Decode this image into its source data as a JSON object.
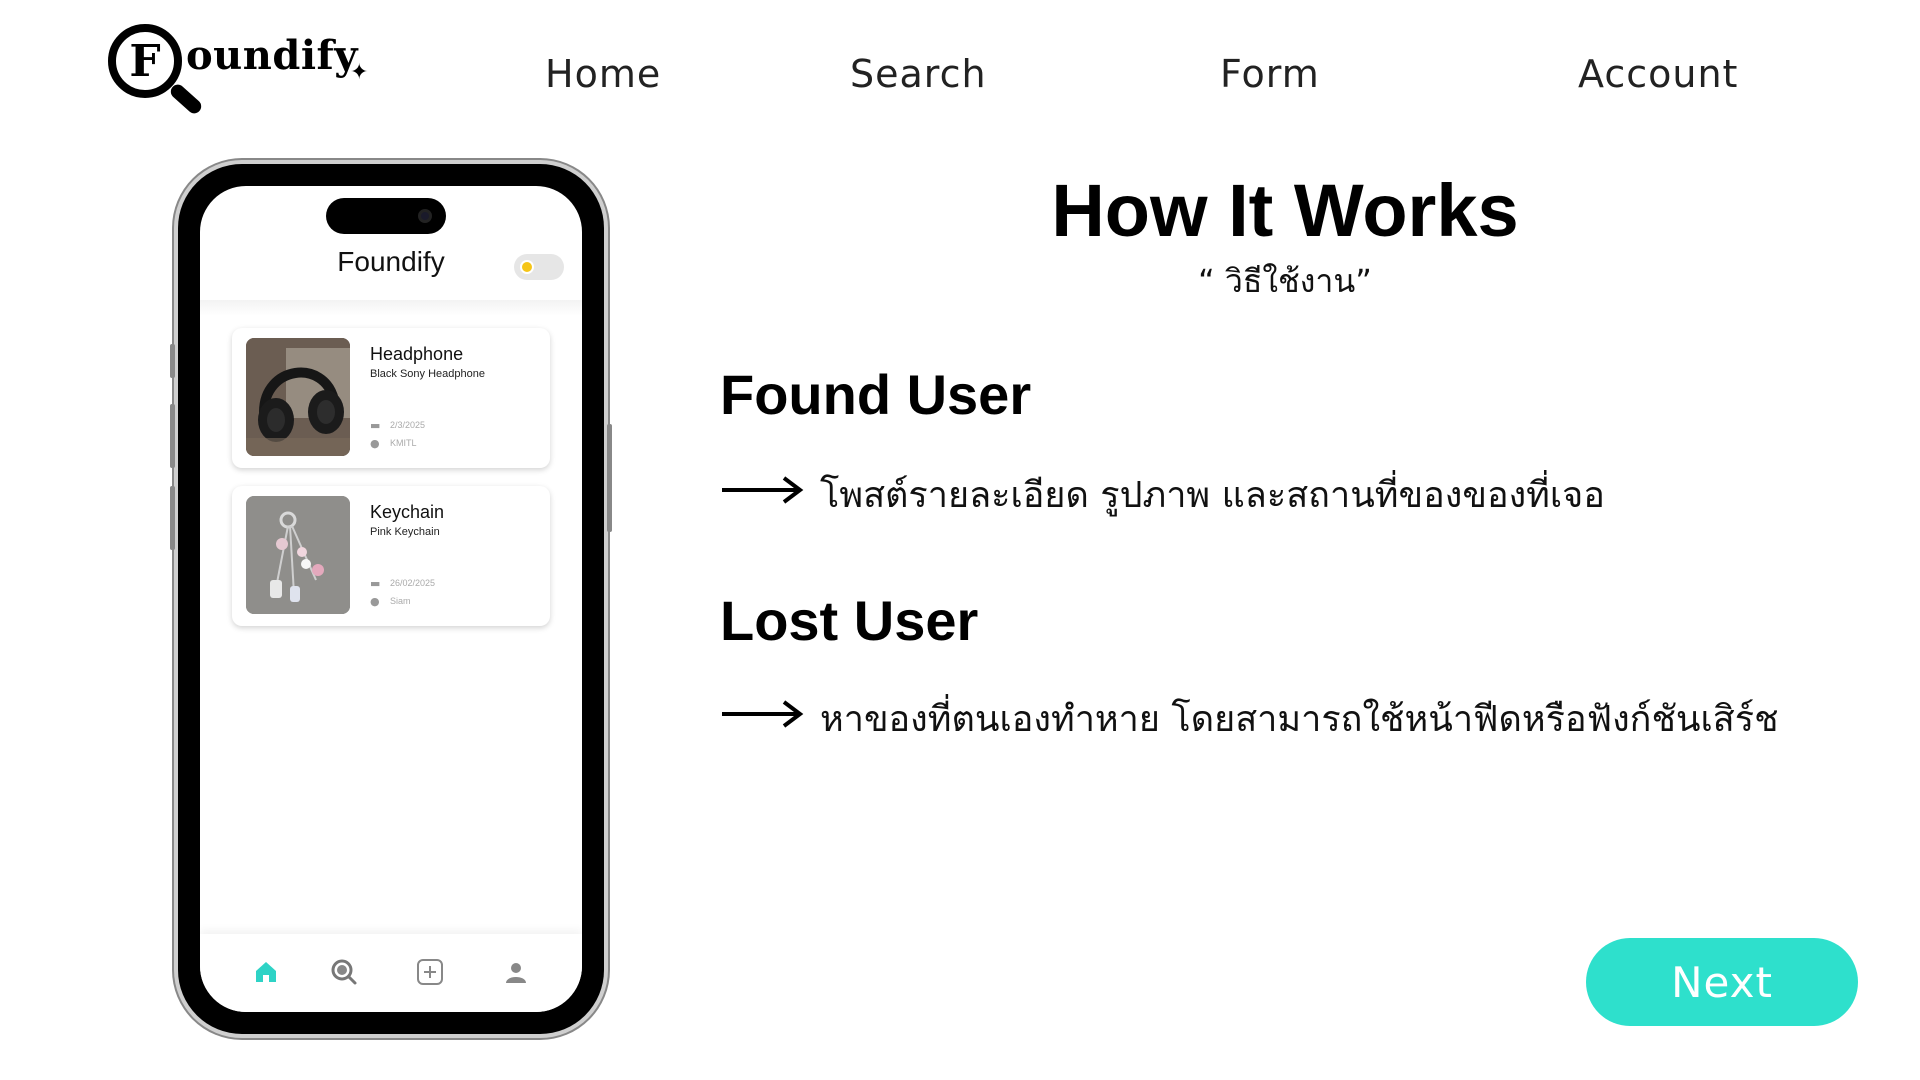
{
  "brand": {
    "logo_letter": "F",
    "logo_text": "oundify"
  },
  "nav": {
    "home": "Home",
    "search": "Search",
    "form": "Form",
    "account": "Account"
  },
  "phone": {
    "app_title": "Foundify",
    "items": [
      {
        "title": "Headphone",
        "subtitle": "Black Sony Headphone",
        "date": "2/3/2025",
        "location": "KMITL"
      },
      {
        "title": "Keychain",
        "subtitle": "Pink Keychain",
        "date": "26/02/2025",
        "location": "Siam"
      }
    ],
    "accent": "#2ed3c6"
  },
  "content": {
    "title": "How It Works",
    "subtitle": "“ วิธีใช้งาน”",
    "found_heading": "Found User",
    "found_desc": "โพสต์รายละเอียด รูปภาพ และสถานที่ของของที่เจอ",
    "lost_heading": "Lost User",
    "lost_desc": "หาของที่ตนเองทำหาย โดยสามารถใช้หน้าฟีดหรือฟังก์ชันเสิร์ช"
  },
  "next_button": {
    "label": "Next",
    "color": "#2ee0cc"
  }
}
